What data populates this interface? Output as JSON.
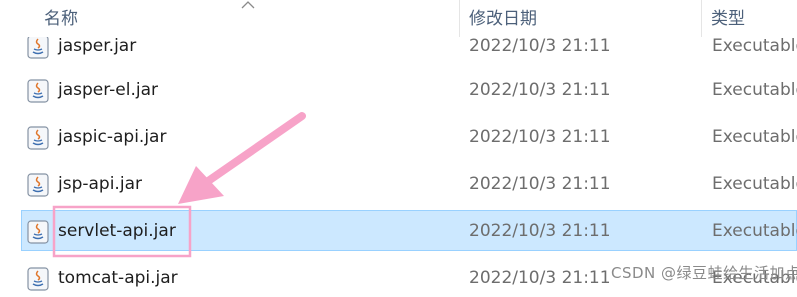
{
  "header": {
    "name_label": "名称",
    "date_label": "修改日期",
    "type_label": "类型"
  },
  "files": [
    {
      "name": "jasper.jar",
      "date": "2022/10/3 21:11",
      "type": "Executable",
      "selected": false
    },
    {
      "name": "jasper-el.jar",
      "date": "2022/10/3 21:11",
      "type": "Executable",
      "selected": false
    },
    {
      "name": "jaspic-api.jar",
      "date": "2022/10/3 21:11",
      "type": "Executable",
      "selected": false
    },
    {
      "name": "jsp-api.jar",
      "date": "2022/10/3 21:11",
      "type": "Executable",
      "selected": false
    },
    {
      "name": "servlet-api.jar",
      "date": "2022/10/3 21:11",
      "type": "Executable",
      "selected": true
    },
    {
      "name": "tomcat-api.jar",
      "date": "2022/10/3 21:11",
      "type": "Executable",
      "selected": false
    }
  ],
  "icons": {
    "file": "java-jar-file-icon",
    "sort": "sort-ascending-chevron-icon"
  },
  "colors": {
    "selection_background": "#cce8ff",
    "selection_border": "#99d1ff",
    "annotation_pink": "#f7a3c8"
  },
  "watermark": "CSDN @绿豆蛙给生活加点甜"
}
